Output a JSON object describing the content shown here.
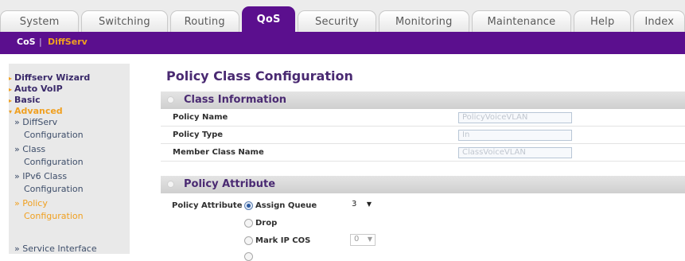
{
  "tabs": [
    {
      "label": "System"
    },
    {
      "label": "Switching"
    },
    {
      "label": "Routing"
    },
    {
      "label": "QoS"
    },
    {
      "label": "Security"
    },
    {
      "label": "Monitoring"
    },
    {
      "label": "Maintenance"
    },
    {
      "label": "Help"
    },
    {
      "label": "Index"
    }
  ],
  "subnav": {
    "cos": "CoS",
    "separator": "|",
    "diffserv": "DiffServ"
  },
  "sidebar": {
    "diffserv_wizard": "Diffserv Wizard",
    "auto_voip": "Auto VoIP",
    "basic": "Basic",
    "advanced": "Advanced",
    "items": [
      {
        "line1": "» DiffServ",
        "line2": "Configuration"
      },
      {
        "line1": "» Class",
        "line2": "Configuration"
      },
      {
        "line1": "» IPv6 Class",
        "line2": "Configuration"
      },
      {
        "line1": "» Policy",
        "line2": "Configuration"
      },
      {
        "line1": "» Service Interface",
        "line2": ""
      }
    ]
  },
  "page_title": "Policy Class Configuration",
  "class_info": {
    "title": "Class Information",
    "rows": [
      {
        "label": "Policy Name",
        "value": "PolicyVoiceVLAN"
      },
      {
        "label": "Policy Type",
        "value": "In"
      },
      {
        "label": "Member Class Name",
        "value": "ClassVoiceVLAN"
      }
    ]
  },
  "policy_attr": {
    "title": "Policy Attribute",
    "label": "Policy Attribute",
    "options": [
      {
        "label": "Assign Queue",
        "checked": true,
        "select_value": "3"
      },
      {
        "label": "Drop",
        "checked": false
      },
      {
        "label": "Mark IP COS",
        "checked": false,
        "select_value": "0"
      }
    ]
  },
  "colors": {
    "accent_purple": "#5b0f8e",
    "sidebar_highlight": "#f0a020",
    "title_purple": "#4a2a72"
  }
}
